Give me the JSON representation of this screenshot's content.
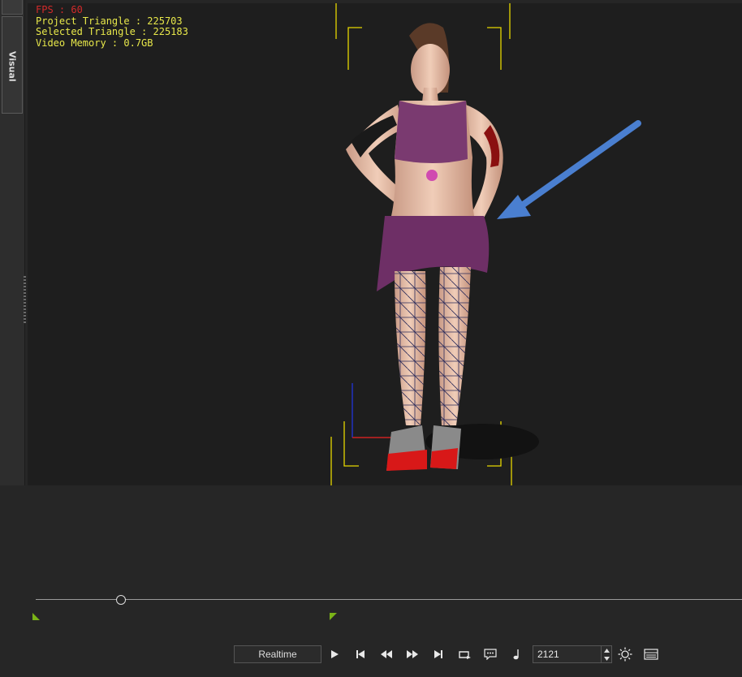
{
  "side_panel": {
    "visual_tab_label": "Visual"
  },
  "viewport": {
    "stats": {
      "fps": "FPS : 60",
      "project_triangle": "Project Triangle : 225703",
      "selected_triangle": "Selected Triangle : 225183",
      "video_memory": "Video Memory : 0.7GB"
    },
    "annotation_color": "#4a7fd0"
  },
  "timeline": {
    "playhead_position": 0.12
  },
  "playback": {
    "realtime_label": "Realtime",
    "frame_value": "2121",
    "icons": [
      "play-icon",
      "go-to-start-icon",
      "step-back-icon",
      "step-forward-icon",
      "go-to-end-icon",
      "loop-icon",
      "subtitle-icon",
      "audio-note-icon",
      "sun-icon",
      "panel-layout-icon"
    ]
  }
}
